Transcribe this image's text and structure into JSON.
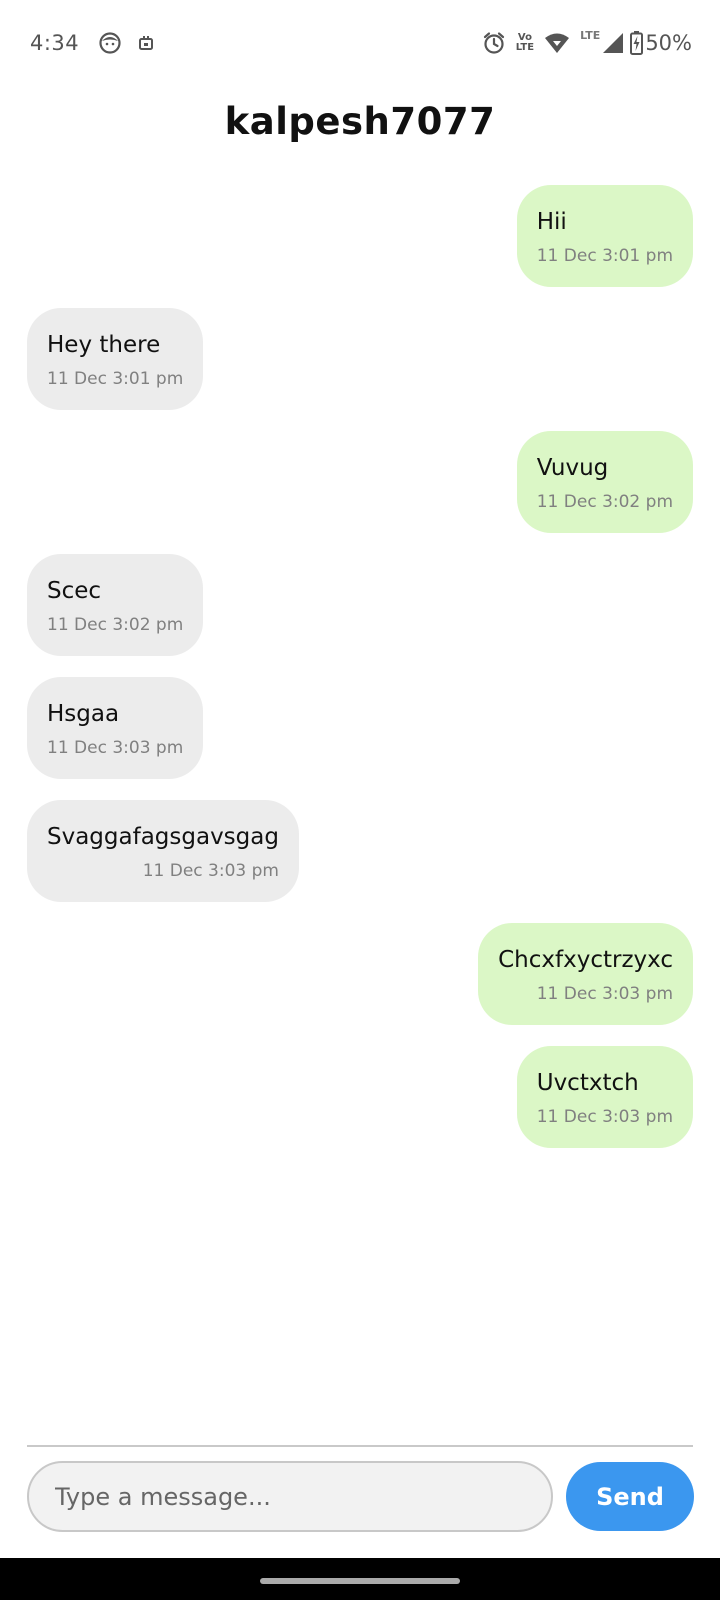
{
  "status_bar": {
    "time": "4:34",
    "icons_left": [
      "face-notification-icon",
      "calendar-notification-icon"
    ],
    "icons_right": [
      "alarm-icon",
      "volte-icon",
      "wifi-icon",
      "lte-signal-icon",
      "battery-charging-icon"
    ],
    "volte_label_top": "Vo",
    "volte_label_bottom": "LTE",
    "lte_label": "LTE",
    "battery": "50%"
  },
  "chat": {
    "title": "kalpesh7077",
    "messages": [
      {
        "direction": "sent",
        "text": "Hii",
        "time": "11 Dec 3:01 pm"
      },
      {
        "direction": "received",
        "text": "Hey there",
        "time": "11 Dec 3:01 pm"
      },
      {
        "direction": "sent",
        "text": "Vuvug",
        "time": "11 Dec 3:02 pm"
      },
      {
        "direction": "received",
        "text": "Scec",
        "time": "11 Dec 3:02 pm"
      },
      {
        "direction": "received",
        "text": "Hsgaa",
        "time": "11 Dec 3:03 pm"
      },
      {
        "direction": "received",
        "text": "Svaggafagsgavsgag",
        "time": "11 Dec 3:03 pm"
      },
      {
        "direction": "sent",
        "text": "Chcxfxyctrzyxc",
        "time": "11 Dec 3:03 pm"
      },
      {
        "direction": "sent",
        "text": "Uvctxtch",
        "time": "11 Dec 3:03 pm"
      }
    ]
  },
  "composer": {
    "placeholder": "Type a message...",
    "value": "",
    "send_label": "Send"
  },
  "colors": {
    "sent_bubble": "#dbf7c6",
    "received_bubble": "#ececec",
    "send_button": "#3b97ef"
  }
}
